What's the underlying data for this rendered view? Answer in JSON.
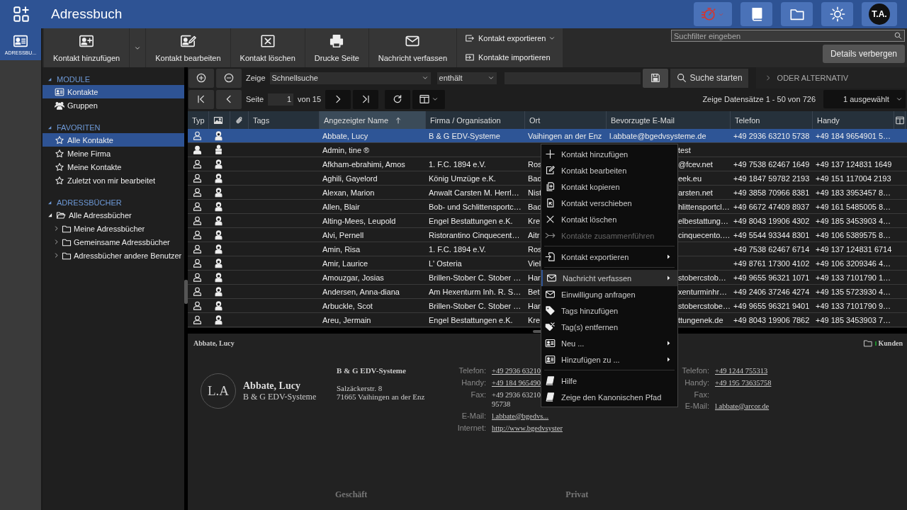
{
  "top_bar": {
    "title": "Adressbuch",
    "avatar": "T.A."
  },
  "rail": [
    {
      "label": "ADRESSBU...",
      "selected": true
    }
  ],
  "toolbar": {
    "buttons": [
      {
        "label": "Kontakt hinzufügen"
      },
      {
        "label": "Kontakt bearbeiten"
      },
      {
        "label": "Kontakt löschen"
      },
      {
        "label": "Drucke Seite"
      },
      {
        "label": "Nachricht verfassen"
      }
    ],
    "stacked": [
      {
        "label": "Kontakt exportieren"
      },
      {
        "label": "Kontakte importieren"
      }
    ],
    "search": {
      "placeholder": "Suchfilter eingeben"
    },
    "details_button": "Details verbergen"
  },
  "sidebar": {
    "sections": [
      {
        "title": "MODULE",
        "expanded": true,
        "items": [
          {
            "label": "Kontakte",
            "selected": true
          },
          {
            "label": "Gruppen",
            "selected": false
          }
        ]
      },
      {
        "title": "FAVORITEN",
        "expanded": true,
        "items": [
          {
            "label": "Alle Kontakte",
            "selected": true
          },
          {
            "label": "Meine Firma",
            "selected": false
          },
          {
            "label": "Meine Kontakte",
            "selected": false
          },
          {
            "label": "Zuletzt von mir bearbeitet",
            "selected": false
          }
        ]
      },
      {
        "title": "ADRESSBÜCHER",
        "expanded": true,
        "tree": [
          {
            "label": "Alle Adressbücher",
            "expanded": true,
            "children": [
              {
                "label": "Meine Adressbücher",
                "expanded": false
              },
              {
                "label": "Gemeinsame Adressbücher",
                "expanded": false
              },
              {
                "label": "Adressbücher andere Benutzer",
                "expanded": false
              }
            ]
          }
        ]
      }
    ]
  },
  "filter": {
    "label": "Zeige",
    "field": "Schnellsuche",
    "operator": "enthält",
    "search_button": "Suche starten",
    "alternative": "ODER ALTERNATIV"
  },
  "pager": {
    "page_label": "Seite",
    "page": "1",
    "of": "von 15",
    "records": "Zeige Datensätze 1 - 50 von 726",
    "selection": "1 ausgewählt"
  },
  "table": {
    "columns": [
      {
        "label": "Typ",
        "sorted": false
      },
      {
        "label": "Tags",
        "sorted": false
      },
      {
        "label": "Angezeigter Name",
        "sorted": true
      },
      {
        "label": "Firma / Organisation",
        "sorted": false
      },
      {
        "label": "Ort",
        "sorted": false
      },
      {
        "label": "Bevorzugte E-Mail",
        "sorted": false
      },
      {
        "label": "Telefon",
        "sorted": false
      },
      {
        "label": "Handy",
        "sorted": false
      }
    ],
    "rows": [
      {
        "kind": "contact",
        "selected": true,
        "name": "Abbate, Lucy",
        "company": "B & G EDV-Systeme",
        "city": "Vaihingen an der Enz",
        "email": "l.abbate@bgedvsysteme.de",
        "phone": "+49 2936 63210 5738",
        "mobile": "+49 184 9654901 5…"
      },
      {
        "kind": "user",
        "selected": false,
        "name": "Admin, tine ®",
        "email": "test"
      },
      {
        "kind": "contact",
        "selected": false,
        "name": "Afkham-ebrahimi, Amos",
        "company": "1. F.C. 1894 e.V.",
        "city": "Ros",
        "email": "@fcev.net",
        "phone": "+49 7538 62467 1649",
        "mobile": "+49 137 124831 1649"
      },
      {
        "kind": "contact",
        "selected": false,
        "name": "Aghili, Gayelord",
        "company": "König Umzüge e.K.",
        "city": "Bad",
        "email": "eek.eu",
        "phone": "+49 1847 59782 2193",
        "mobile": "+49 151 117004 2193"
      },
      {
        "kind": "contact",
        "selected": false,
        "name": "Alexan, Marion",
        "company": "Anwalt Carsten M. Herrl…",
        "city": "Nist",
        "email": "arsten.net",
        "phone": "+49 3858 70966 8381",
        "mobile": "+49 183 3953457 8…"
      },
      {
        "kind": "contact",
        "selected": false,
        "name": "Allen, Blair",
        "company": "Bob- und Schlittensportc…",
        "city": "Bad",
        "email": "hlittensportcl…",
        "phone": "+49 6672 47409 8937",
        "mobile": "+49 161 5485005 8…"
      },
      {
        "kind": "contact",
        "selected": false,
        "name": "Alting-Mees, Leupold",
        "company": "Engel Bestattungen e.K.",
        "city": "Kre",
        "email": "elbestattung…",
        "phone": "+49 8043 19906 4302",
        "mobile": "+49 185 3453903 4…"
      },
      {
        "kind": "contact",
        "selected": false,
        "name": "Alvi, Pernell",
        "company": "Ristorantino Cinquecent…",
        "city": "Aitr",
        "email": "cinquecento.…",
        "phone": "+49 5544 93344 8301",
        "mobile": "+49 106 5389575 8…"
      },
      {
        "kind": "contact",
        "selected": false,
        "name": "Amin, Risa",
        "company": "1. F.C. 1894 e.V.",
        "city": "Ros",
        "phone": "+49 7538 62467 6714",
        "mobile": "+49 137 124831 6714"
      },
      {
        "kind": "contact",
        "selected": false,
        "name": "Amir, Laurice",
        "company": "L' Osteria",
        "city": "Viel",
        "phone": "+49 8761 17300 4102",
        "mobile": "+49 106 3209346 4…"
      },
      {
        "kind": "contact",
        "selected": false,
        "name": "Amouzgar, Josias",
        "company": "Brillen-Stober C. Stober …",
        "city": "Har",
        "email": "stobercstob…",
        "phone": "+49 9655 96321 1071",
        "mobile": "+49 133 7101790 1…"
      },
      {
        "kind": "contact",
        "selected": false,
        "name": "Andersen, Anna-diana",
        "company": "Am Hexenturm Inh. R. S…",
        "city": "Bet",
        "email": "xenturminhr…",
        "phone": "+49 2406 37246 4274",
        "mobile": "+49 135 5723930 4…"
      },
      {
        "kind": "contact",
        "selected": false,
        "name": "Arbuckle, Scot",
        "company": "Brillen-Stober C. Stober …",
        "city": "Har",
        "email": "stobercstobe…",
        "phone": "+49 9655 96321 9401",
        "mobile": "+49 133 7101790 9…"
      },
      {
        "kind": "contact",
        "selected": false,
        "name": "Areu, Jermain",
        "company": "Engel Bestattungen e.K.",
        "city": "Kre",
        "email": "ttungenek.de",
        "phone": "+49 8043 19906 7862",
        "mobile": "+49 185 3453903 7…"
      }
    ]
  },
  "context_menu": {
    "groups": [
      [
        {
          "label": "Kontakt hinzufügen",
          "disabled": false,
          "submenu": false,
          "selected": false
        },
        {
          "label": "Kontakt bearbeiten",
          "disabled": false,
          "submenu": false,
          "selected": false
        },
        {
          "label": "Kontakt kopieren",
          "disabled": false,
          "submenu": false,
          "selected": false
        },
        {
          "label": "Kontakt verschieben",
          "disabled": false,
          "submenu": false,
          "selected": false
        },
        {
          "label": "Kontakt löschen",
          "disabled": false,
          "submenu": false,
          "selected": false
        },
        {
          "label": "Kontakte zusammenführen",
          "disabled": true,
          "submenu": false,
          "selected": false
        }
      ],
      [
        {
          "label": "Kontakt exportieren",
          "disabled": false,
          "submenu": true,
          "selected": false
        }
      ],
      [
        {
          "label": "Nachricht verfassen",
          "disabled": false,
          "submenu": true,
          "selected": true
        },
        {
          "label": "Einwilligung anfragen",
          "disabled": false,
          "submenu": false,
          "selected": false
        },
        {
          "label": "Tags hinzufügen",
          "disabled": false,
          "submenu": false,
          "selected": false
        },
        {
          "label": "Tag(s) entfernen",
          "disabled": false,
          "submenu": false,
          "selected": false
        },
        {
          "label": "Neu ...",
          "disabled": false,
          "submenu": true,
          "selected": false
        },
        {
          "label": "Hinzufügen zu ...",
          "disabled": false,
          "submenu": true,
          "selected": false
        }
      ],
      [
        {
          "label": "Hilfe",
          "disabled": false,
          "submenu": false,
          "selected": false
        },
        {
          "label": "Zeige den Kanonischen Pfad",
          "disabled": false,
          "submenu": false,
          "selected": false
        }
      ]
    ]
  },
  "details": {
    "title": "Abbate, Lucy",
    "tag": "Kunden",
    "initials": "L.A",
    "name": "Abbate, Lucy",
    "company": "B & G EDV-Systeme",
    "org": "B & G EDV-Systeme",
    "street": "Salzäckerstr. 8",
    "city": "71665 Vaihingen an der Enz",
    "business": [
      {
        "label": "Telefon:",
        "value": "+49 2936 63210",
        "link": true
      },
      {
        "label": "Handy:",
        "value": "+49 184 965490",
        "link": true
      },
      {
        "label": "Fax:",
        "value": "+49 2936 63210 95738",
        "link": false
      },
      {
        "label": "E-Mail:",
        "value": "l.abbate@bgedvs...",
        "link": true
      },
      {
        "label": "Internet:",
        "value": "http://www.bgedvsyster",
        "link": true
      }
    ],
    "private": [
      {
        "label": "Telefon:",
        "value": "+49 1244 755313",
        "link": true
      },
      {
        "label": "Handy:",
        "value": "+49 195 73635758",
        "link": true
      },
      {
        "label": "Fax:"
      },
      {
        "label": "E-Mail:",
        "value": "l.abbate@arcor.de",
        "link": true
      }
    ],
    "sections": [
      "Geschäft",
      "Privat"
    ]
  }
}
